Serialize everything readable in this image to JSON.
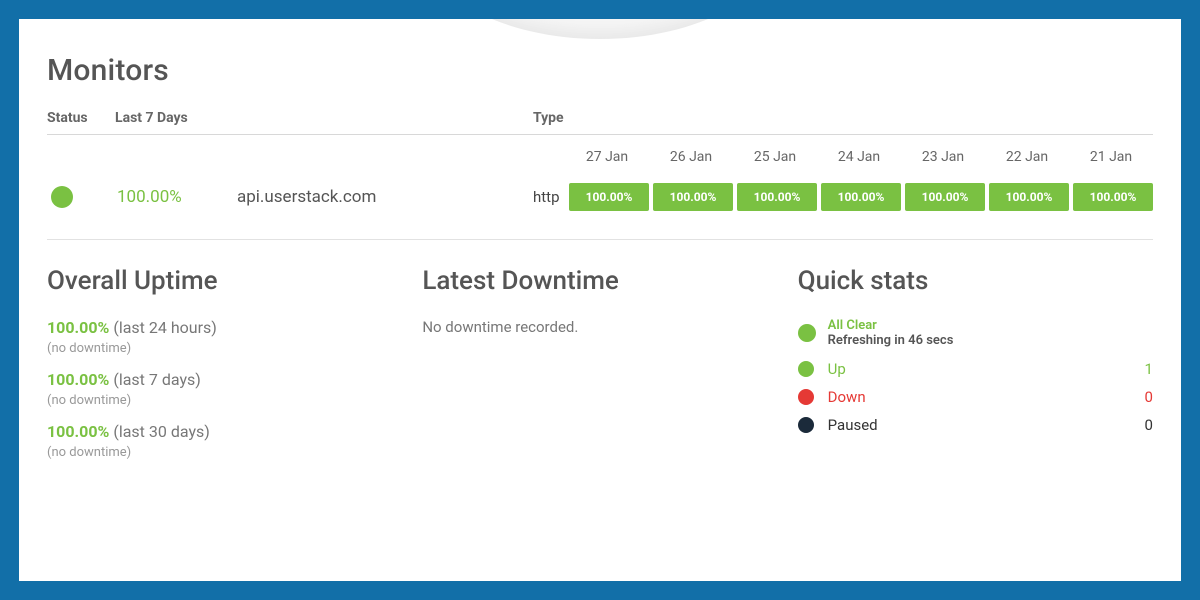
{
  "page": {
    "title": "Monitors"
  },
  "table": {
    "headers": {
      "status": "Status",
      "last7": "Last 7 Days",
      "type": "Type"
    },
    "dates": [
      "27 Jan",
      "26 Jan",
      "25 Jan",
      "24 Jan",
      "23 Jan",
      "22 Jan",
      "21 Jan"
    ],
    "row": {
      "uptime": "100.00%",
      "name": "api.userstack.com",
      "type": "http",
      "days": [
        "100.00%",
        "100.00%",
        "100.00%",
        "100.00%",
        "100.00%",
        "100.00%",
        "100.00%"
      ]
    }
  },
  "overall": {
    "title": "Overall Uptime",
    "items": [
      {
        "pct": "100.00%",
        "range": "(last 24 hours)",
        "note": "(no downtime)"
      },
      {
        "pct": "100.00%",
        "range": "(last 7 days)",
        "note": "(no downtime)"
      },
      {
        "pct": "100.00%",
        "range": "(last 30 days)",
        "note": "(no downtime)"
      }
    ]
  },
  "downtime": {
    "title": "Latest Downtime",
    "message": "No downtime recorded."
  },
  "quickstats": {
    "title": "Quick stats",
    "status_line1": "All Clear",
    "status_line2": "Refreshing in 46 secs",
    "rows": {
      "up": {
        "label": "Up",
        "count": "1"
      },
      "down": {
        "label": "Down",
        "count": "0"
      },
      "paused": {
        "label": "Paused",
        "count": "0"
      }
    }
  },
  "colors": {
    "green": "#7ac142",
    "red": "#e53935",
    "dark": "#1b2a3a"
  }
}
